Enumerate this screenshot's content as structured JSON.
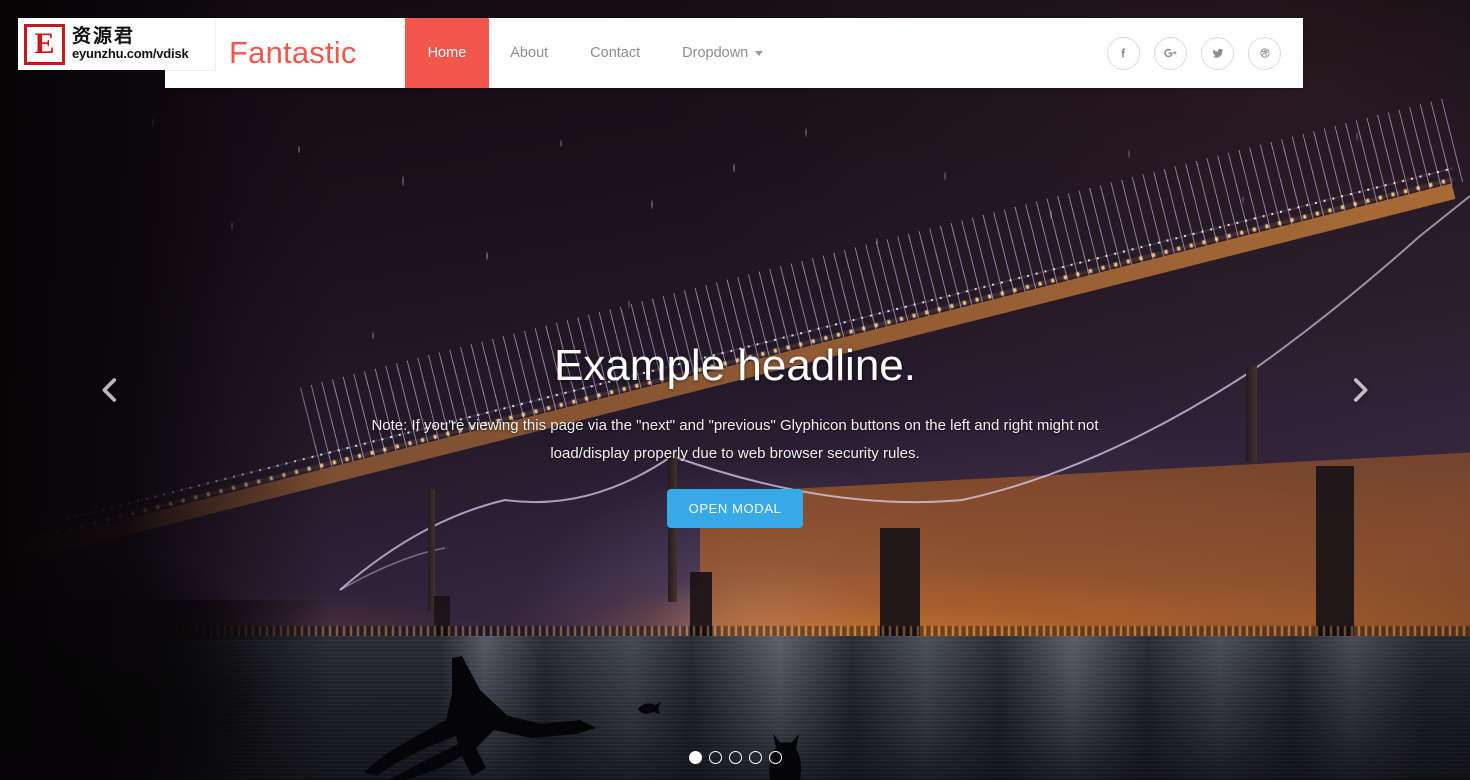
{
  "watermark": {
    "letter": "E",
    "chinese": "资源君",
    "url": "eyunzhu.com/vdisk"
  },
  "navbar": {
    "brand": "Fantastic",
    "brand_color": "#f2594d",
    "active_color": "#f2574b",
    "links": [
      {
        "label": "Home",
        "active": true
      },
      {
        "label": "About",
        "active": false
      },
      {
        "label": "Contact",
        "active": false
      },
      {
        "label": "Dropdown",
        "active": false,
        "has_caret": true
      }
    ],
    "socials": [
      {
        "name": "facebook-icon",
        "label": "Facebook"
      },
      {
        "name": "google-plus-icon",
        "label": "Google+"
      },
      {
        "name": "twitter-icon",
        "label": "Twitter"
      },
      {
        "name": "dribbble-icon",
        "label": "Dribbble"
      }
    ]
  },
  "carousel": {
    "headline": "Example headline.",
    "lede": "Note: If you're viewing this page via the \"next\" and \"previous\" Glyphicon buttons on the left and right might not load/display properly due to web browser security rules.",
    "button_label": "OPEN MODAL",
    "button_color": "#37a9e8",
    "prev_label": "Previous",
    "next_label": "Next",
    "indicators": [
      {
        "index": 1,
        "active": true
      },
      {
        "index": 2,
        "active": false
      },
      {
        "index": 3,
        "active": false
      },
      {
        "index": 4,
        "active": false
      },
      {
        "index": 5,
        "active": false
      }
    ]
  }
}
